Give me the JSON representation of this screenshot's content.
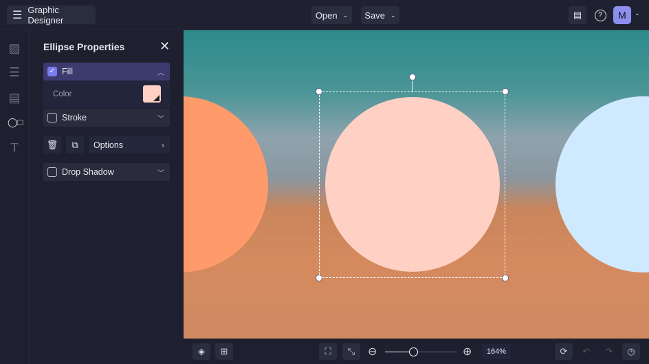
{
  "header": {
    "app_title": "Graphic Designer",
    "open_label": "Open",
    "save_label": "Save",
    "avatar_letter": "M"
  },
  "panel": {
    "title": "Ellipse Properties",
    "fill_label": "Fill",
    "fill_checked": true,
    "color_label": "Color",
    "fill_color": "#ffd0c4",
    "stroke_label": "Stroke",
    "options_label": "Options",
    "drop_shadow_label": "Drop Shadow"
  },
  "canvas": {
    "shapes": [
      {
        "color": "#ff9a6a"
      },
      {
        "color": "#ffd0c4"
      },
      {
        "color": "#cfeaff"
      }
    ]
  },
  "bottom": {
    "zoom_value": "164%",
    "zoom_fraction": 0.4
  }
}
